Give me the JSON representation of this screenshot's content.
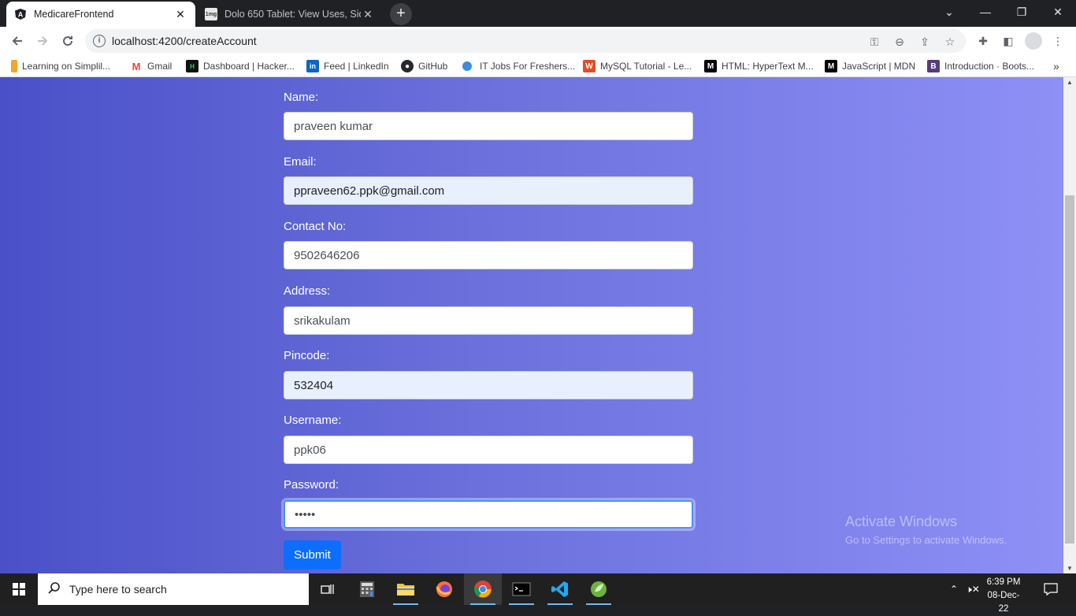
{
  "browser": {
    "tabs": [
      {
        "title": "MedicareFrontend",
        "active": true
      },
      {
        "title": "Dolo 650 Tablet: View Uses, Side",
        "active": false
      }
    ],
    "url": "localhost:4200/createAccount",
    "bookmarks": [
      {
        "label": "Learning on Simplil..."
      },
      {
        "label": "Gmail"
      },
      {
        "label": "Dashboard | Hacker..."
      },
      {
        "label": "Feed | LinkedIn"
      },
      {
        "label": "GitHub"
      },
      {
        "label": "IT Jobs For Freshers..."
      },
      {
        "label": "MySQL Tutorial - Le..."
      },
      {
        "label": "HTML: HyperText M..."
      },
      {
        "label": "JavaScript | MDN"
      },
      {
        "label": "Introduction · Boots..."
      }
    ],
    "overflow": "»"
  },
  "form": {
    "fields": [
      {
        "label": "Name:",
        "value": "praveen kumar"
      },
      {
        "label": "Email:",
        "value": "ppraveen62.ppk@gmail.com"
      },
      {
        "label": "Contact No:",
        "value": "9502646206"
      },
      {
        "label": "Address:",
        "value": "srikakulam"
      },
      {
        "label": "Pincode:",
        "value": "532404"
      },
      {
        "label": "Username:",
        "value": "ppk06"
      },
      {
        "label": "Password:",
        "value": "•••••"
      }
    ],
    "submit_label": "Submit"
  },
  "watermark": {
    "line1": "Activate Windows",
    "line2": "Go to Settings to activate Windows."
  },
  "taskbar": {
    "search_placeholder": "Type here to search",
    "time": "6:39 PM",
    "date": "08-Dec-22"
  },
  "colors": {
    "accent": "#0d6efd",
    "autofill": "#e8f0fe",
    "gradient_start": "#4a50c8",
    "gradient_end": "#8e90f6"
  }
}
